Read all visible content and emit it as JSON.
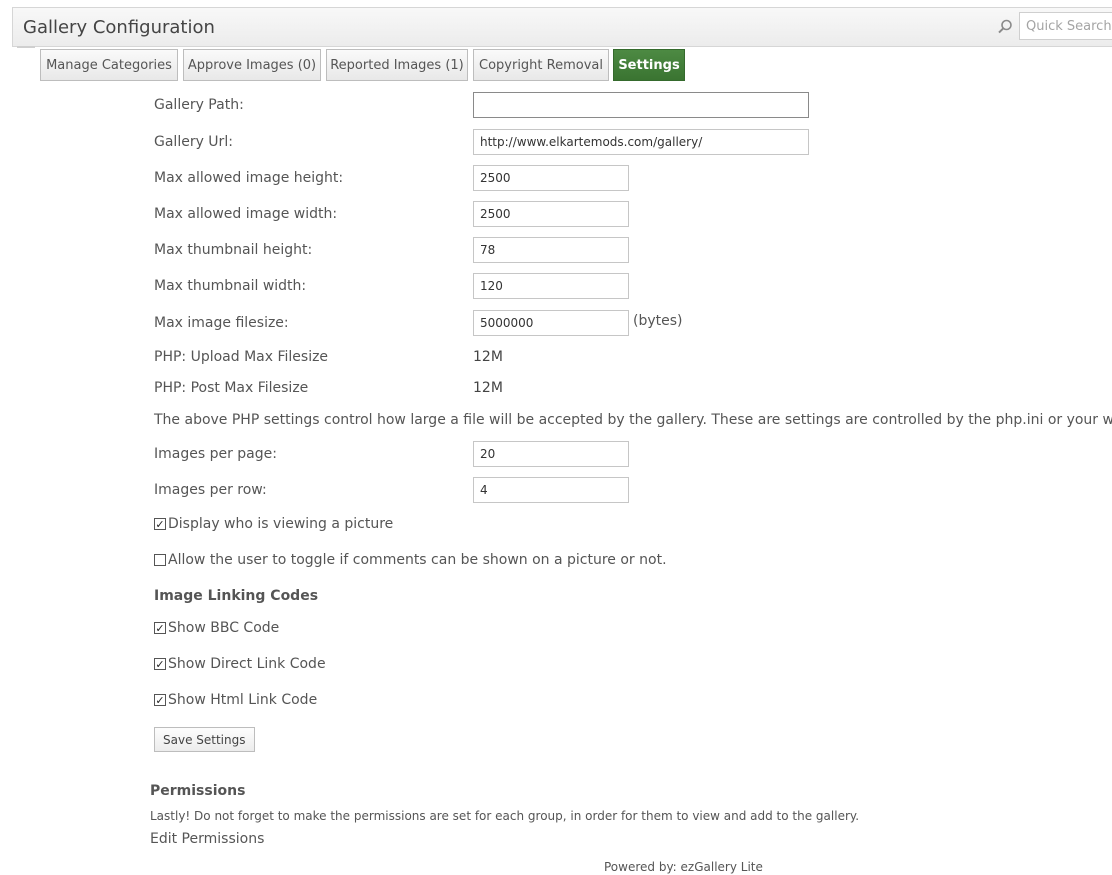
{
  "header": {
    "title": "Gallery Configuration",
    "search_placeholder": "Quick Search",
    "search_icon": "magnifier"
  },
  "tabs": [
    {
      "label": "Manage Categories"
    },
    {
      "label": "Approve Images (0)"
    },
    {
      "label": "Reported Images (1)"
    },
    {
      "label": "Copyright Removal"
    },
    {
      "label": "Settings",
      "active": true
    }
  ],
  "settings": {
    "gallery_path": {
      "label": "Gallery Path:",
      "value": ""
    },
    "gallery_url": {
      "label": "Gallery Url:",
      "value": "http://www.elkartemods.com/gallery/"
    },
    "max_height": {
      "label": "Max allowed image height:",
      "value": "2500"
    },
    "max_width": {
      "label": "Max allowed image width:",
      "value": "2500"
    },
    "thumb_height": {
      "label": "Max thumbnail height:",
      "value": "78"
    },
    "thumb_width": {
      "label": "Max thumbnail width:",
      "value": "120"
    },
    "max_filesize": {
      "label": "Max image filesize:",
      "value": "5000000",
      "unit": "(bytes)"
    },
    "php_upload": {
      "label": "PHP: Upload Max Filesize",
      "value": "12M"
    },
    "php_post": {
      "label": "PHP: Post Max Filesize",
      "value": "12M"
    },
    "php_note": "The above PHP settings control how large a file will be accepted by the gallery. These are settings are controlled by the php.ini or your webhost",
    "images_per_page": {
      "label": "Images per page:",
      "value": "20"
    },
    "images_per_row": {
      "label": "Images per row:",
      "value": "4"
    },
    "display_viewing": {
      "label": "Display who is viewing a picture",
      "checked": true
    },
    "toggle_comments": {
      "label": "Allow the user to toggle if comments can be shown on a picture or not.",
      "checked": false
    }
  },
  "linking": {
    "heading": "Image Linking Codes",
    "bbc": {
      "label": "Show BBC Code",
      "checked": true
    },
    "direct": {
      "label": "Show Direct Link Code",
      "checked": true
    },
    "html": {
      "label": "Show Html Link Code",
      "checked": true
    }
  },
  "save_label": "Save Settings",
  "permissions": {
    "heading": "Permissions",
    "text": "Lastly! Do not forget to make the permissions are set for each group, in order for them to view and add to the gallery.",
    "link": "Edit Permissions"
  },
  "footer": {
    "powered": "Powered by: ezGallery Lite"
  }
}
